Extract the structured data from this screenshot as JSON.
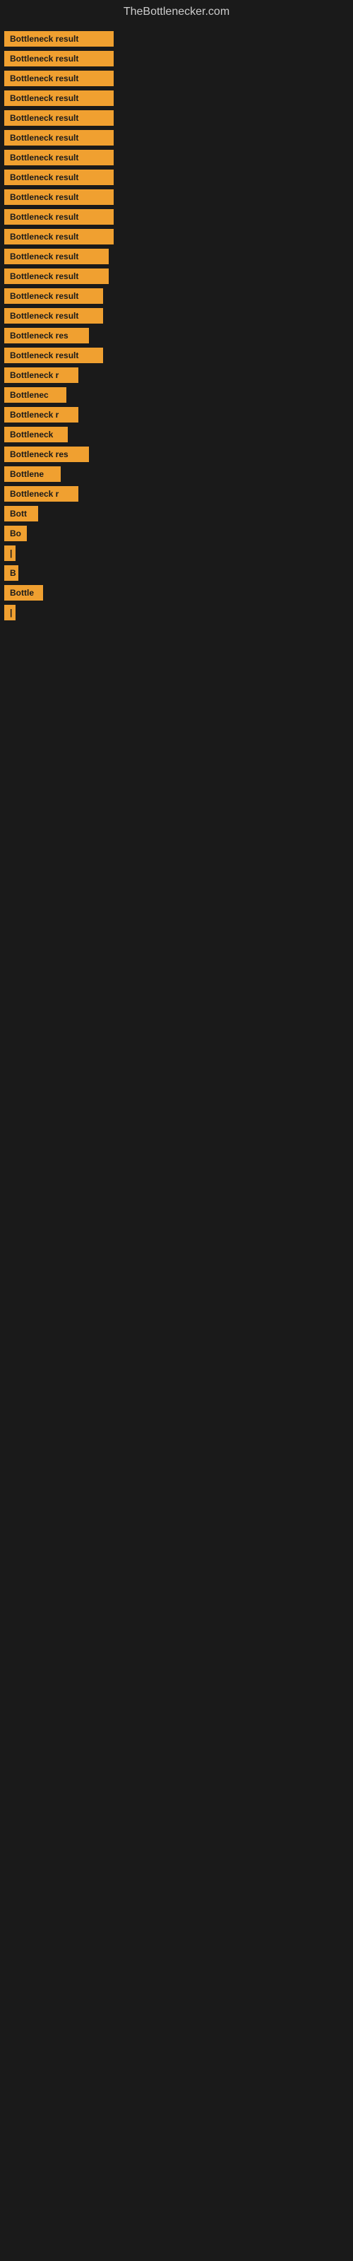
{
  "site_title": "TheBottlenecker.com",
  "items": [
    {
      "label": "Bottleneck result",
      "width": 155
    },
    {
      "label": "Bottleneck result",
      "width": 155
    },
    {
      "label": "Bottleneck result",
      "width": 155
    },
    {
      "label": "Bottleneck result",
      "width": 155
    },
    {
      "label": "Bottleneck result",
      "width": 155
    },
    {
      "label": "Bottleneck result",
      "width": 155
    },
    {
      "label": "Bottleneck result",
      "width": 155
    },
    {
      "label": "Bottleneck result",
      "width": 155
    },
    {
      "label": "Bottleneck result",
      "width": 155
    },
    {
      "label": "Bottleneck result",
      "width": 155
    },
    {
      "label": "Bottleneck result",
      "width": 155
    },
    {
      "label": "Bottleneck result",
      "width": 148
    },
    {
      "label": "Bottleneck result",
      "width": 148
    },
    {
      "label": "Bottleneck result",
      "width": 140
    },
    {
      "label": "Bottleneck result",
      "width": 140
    },
    {
      "label": "Bottleneck res",
      "width": 120
    },
    {
      "label": "Bottleneck result",
      "width": 140
    },
    {
      "label": "Bottleneck r",
      "width": 105
    },
    {
      "label": "Bottlenec",
      "width": 88
    },
    {
      "label": "Bottleneck r",
      "width": 105
    },
    {
      "label": "Bottleneck",
      "width": 90
    },
    {
      "label": "Bottleneck res",
      "width": 120
    },
    {
      "label": "Bottlene",
      "width": 80
    },
    {
      "label": "Bottleneck r",
      "width": 105
    },
    {
      "label": "Bott",
      "width": 48
    },
    {
      "label": "Bo",
      "width": 32
    },
    {
      "label": "|",
      "width": 10
    },
    {
      "label": "B",
      "width": 20
    },
    {
      "label": "Bottle",
      "width": 55
    },
    {
      "label": "|",
      "width": 8
    }
  ]
}
